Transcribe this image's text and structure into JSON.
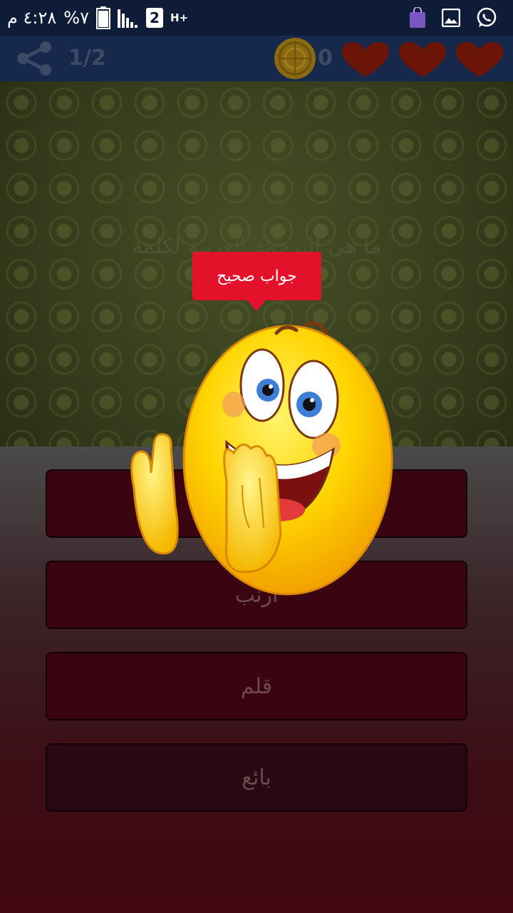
{
  "status_bar": {
    "time": "٤:٢٨ م",
    "battery_percent": "%٧",
    "sim_label": "2",
    "network_label": "H+",
    "icons": [
      "whatsapp-icon",
      "gallery-icon",
      "shopping-bag-icon",
      "sim-icon",
      "signal-icon",
      "battery-icon"
    ]
  },
  "app_bar": {
    "progress": "1/2",
    "coins": "0",
    "lives": 3,
    "heart_color": "#6b1508",
    "coin_color": "#8a6a10"
  },
  "question": {
    "text": "ما هي الترجمة العربية لكلمة"
  },
  "answers": [
    {
      "label": ""
    },
    {
      "label": "أرنب"
    },
    {
      "label": "قلم"
    },
    {
      "label": "بائع"
    }
  ],
  "feedback": {
    "toast": "جواب صحيح",
    "toast_color": "#e3122a"
  }
}
